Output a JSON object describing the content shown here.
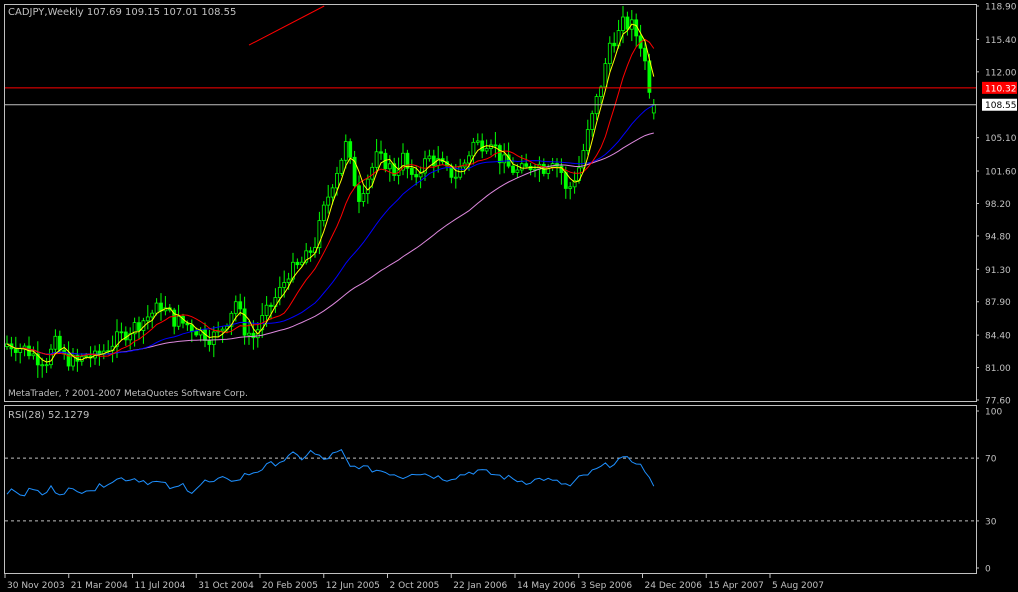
{
  "window": {
    "symbol_header": "CADJPY,Weekly  107.69 109.15 107.01 108.55",
    "copyright": "MetaTrader, ? 2001-2007 MetaQuotes Software Corp."
  },
  "colors": {
    "background": "#000000",
    "axis": "#c0c0c0",
    "bull": "#00ff00",
    "bear": "#00ff00",
    "ma_fast": "#ffff00",
    "ma_mid": "#ff0000",
    "ma_slow": "#0000ff",
    "ma_slowest": "#dd88dd",
    "trendline": "#ff0000",
    "hline": "#ff0000",
    "price_line": "#c0c0c0",
    "rsi": "#1e90ff",
    "rsi_levels": "#c0c0c0",
    "tag_red": "#ff0000",
    "tag_text": "#ffffff"
  },
  "chart_data": [
    {
      "type": "candlestick",
      "timeframe": "Weekly",
      "symbol": "CADJPY",
      "ohlc_last": {
        "open": 107.69,
        "high": 109.15,
        "low": 107.01,
        "close": 108.55
      },
      "y_ticks": [
        "118.90",
        "115.40",
        "112.00",
        "108.55",
        "105.10",
        "101.60",
        "98.20",
        "94.80",
        "91.30",
        "87.90",
        "84.40",
        "81.00",
        "77.60"
      ],
      "y_tick_values": [
        118.9,
        115.4,
        112.0,
        108.55,
        105.1,
        101.6,
        98.2,
        94.8,
        91.3,
        87.9,
        84.4,
        81.0,
        77.6
      ],
      "ylim": [
        77.6,
        118.9
      ],
      "x_labels": [
        "30 Nov 2003",
        "21 Mar 2004",
        "11 Jul 2004",
        "31 Oct 2004",
        "20 Feb 2005",
        "12 Jun 2005",
        "2 Oct 2005",
        "22 Jan 2006",
        "14 May 2006",
        "3 Sep 2006",
        "24 Dec 2006",
        "15 Apr 2007",
        "5 Aug 2007"
      ],
      "price_tag_red": "110.32",
      "price_tag_current": "108.55",
      "horizontal_line": 110.32,
      "trendline": {
        "from": [
          55,
          114.8
        ],
        "to": [
          63,
          119.5
        ]
      },
      "close_keypoints": [
        [
          0,
          83.5
        ],
        [
          4,
          83.0
        ],
        [
          7,
          82.0
        ],
        [
          9,
          81.8
        ],
        [
          11,
          83.5
        ],
        [
          13,
          82.0
        ],
        [
          16,
          81.5
        ],
        [
          18,
          82.3
        ],
        [
          20,
          82.0
        ],
        [
          22,
          82.8
        ],
        [
          25,
          84.0
        ],
        [
          28,
          85.0
        ],
        [
          31,
          86.0
        ],
        [
          35,
          87.5
        ],
        [
          38,
          86.0
        ],
        [
          41,
          85.5
        ],
        [
          43,
          85.0
        ],
        [
          46,
          84.2
        ],
        [
          48,
          84.5
        ],
        [
          50,
          86.0
        ],
        [
          52,
          88.0
        ],
        [
          54,
          85.0
        ],
        [
          56,
          84.2
        ],
        [
          58,
          86.0
        ],
        [
          60,
          87.5
        ],
        [
          62,
          89.0
        ],
        [
          64,
          91.0
        ],
        [
          66,
          91.5
        ],
        [
          68,
          92.5
        ],
        [
          70,
          94.0
        ],
        [
          72,
          97.5
        ],
        [
          74,
          100.5
        ],
        [
          76,
          103.0
        ],
        [
          77,
          104.3
        ],
        [
          79,
          100.5
        ],
        [
          80,
          99.0
        ],
        [
          82,
          101.0
        ],
        [
          84,
          103.0
        ],
        [
          86,
          102.5
        ],
        [
          88,
          101.5
        ],
        [
          90,
          103.0
        ],
        [
          92,
          100.5
        ],
        [
          94,
          102.0
        ],
        [
          96,
          103.0
        ],
        [
          98,
          102.5
        ],
        [
          100,
          101.5
        ],
        [
          102,
          101.2
        ],
        [
          104,
          102.5
        ],
        [
          106,
          104.5
        ],
        [
          108,
          104.5
        ],
        [
          110,
          105.0
        ],
        [
          112,
          103.0
        ],
        [
          114,
          102.0
        ],
        [
          116,
          101.5
        ],
        [
          118,
          101.8
        ],
        [
          120,
          102.5
        ],
        [
          122,
          102.0
        ],
        [
          124,
          103.0
        ],
        [
          126,
          101.5
        ],
        [
          127,
          99.5
        ],
        [
          128,
          100.0
        ],
        [
          130,
          102.0
        ],
        [
          132,
          105.5
        ],
        [
          134,
          109.0
        ],
        [
          136,
          112.5
        ],
        [
          137,
          115.0
        ],
        [
          139,
          116.0
        ],
        [
          140,
          117.0
        ],
        [
          142,
          116.8
        ],
        [
          144,
          115.0
        ],
        [
          145,
          113.0
        ],
        [
          146,
          110.5
        ],
        [
          147,
          108.55
        ]
      ],
      "moving_averages": [
        "ma_fast",
        "ma_mid",
        "ma_slow",
        "ma_slowest"
      ]
    },
    {
      "type": "line",
      "title": "RSI(28) 52.1279",
      "y_ticks": [
        "100",
        "70",
        "30",
        "0"
      ],
      "y_tick_values": [
        100,
        70,
        30,
        0
      ],
      "levels": [
        70,
        30
      ],
      "ylim": [
        0,
        100
      ],
      "rsi_keypoints": [
        [
          0,
          49
        ],
        [
          4,
          47
        ],
        [
          6,
          51
        ],
        [
          8,
          46
        ],
        [
          10,
          51
        ],
        [
          12,
          48
        ],
        [
          14,
          50
        ],
        [
          16,
          48
        ],
        [
          18,
          51
        ],
        [
          20,
          50
        ],
        [
          23,
          55
        ],
        [
          26,
          57
        ],
        [
          29,
          57
        ],
        [
          32,
          55
        ],
        [
          35,
          54
        ],
        [
          38,
          50
        ],
        [
          40,
          53
        ],
        [
          42,
          49
        ],
        [
          45,
          55
        ],
        [
          47,
          54
        ],
        [
          50,
          58
        ],
        [
          52,
          55
        ],
        [
          54,
          59
        ],
        [
          57,
          62
        ],
        [
          60,
          66
        ],
        [
          63,
          69
        ],
        [
          65,
          72
        ],
        [
          67,
          70
        ],
        [
          69,
          74
        ],
        [
          72,
          69
        ],
        [
          74,
          72
        ],
        [
          76,
          74
        ],
        [
          78,
          64
        ],
        [
          80,
          65
        ],
        [
          82,
          63
        ],
        [
          85,
          62
        ],
        [
          88,
          60
        ],
        [
          90,
          58
        ],
        [
          92,
          61
        ],
        [
          95,
          60
        ],
        [
          98,
          58
        ],
        [
          100,
          57
        ],
        [
          103,
          59
        ],
        [
          105,
          61
        ],
        [
          107,
          62
        ],
        [
          110,
          60
        ],
        [
          113,
          58
        ],
        [
          116,
          56
        ],
        [
          118,
          55
        ],
        [
          120,
          56
        ],
        [
          122,
          57
        ],
        [
          124,
          55
        ],
        [
          126,
          54
        ],
        [
          128,
          52
        ],
        [
          130,
          57
        ],
        [
          133,
          61
        ],
        [
          135,
          64
        ],
        [
          137,
          66
        ],
        [
          139,
          69
        ],
        [
          141,
          69
        ],
        [
          143,
          68
        ],
        [
          145,
          62
        ],
        [
          146,
          57
        ],
        [
          147,
          52.1279
        ]
      ]
    }
  ]
}
